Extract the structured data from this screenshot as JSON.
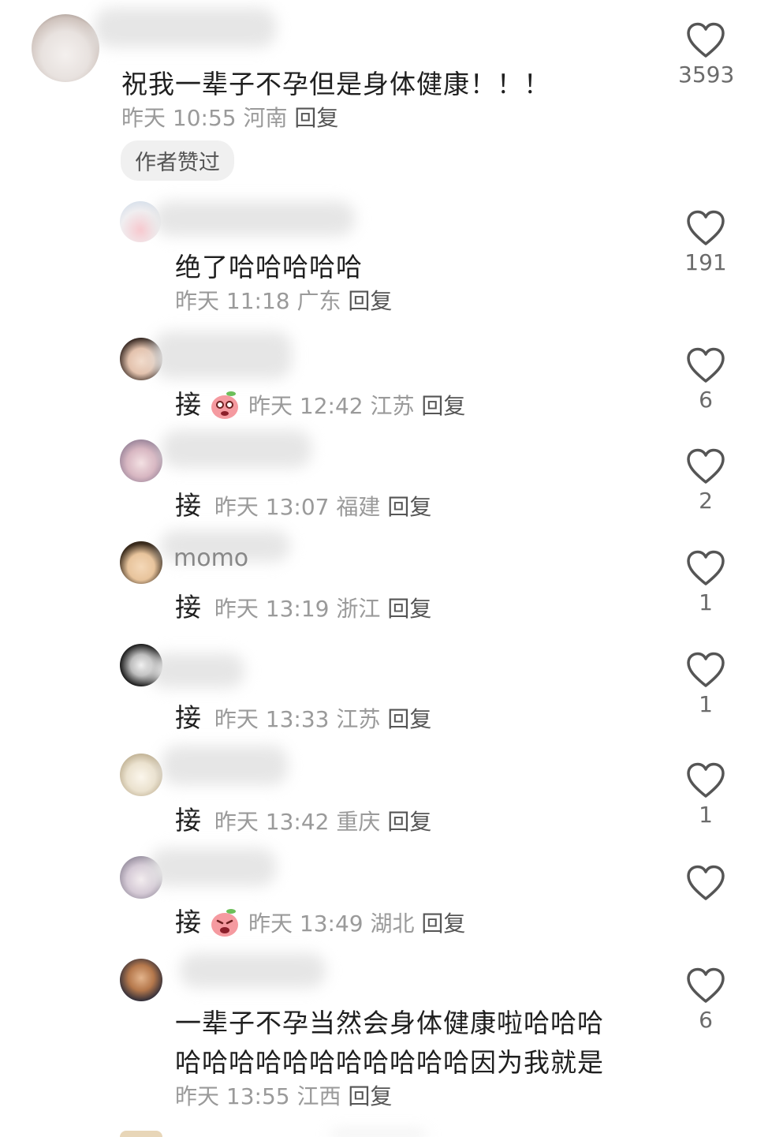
{
  "comments": [
    {
      "text": "祝我一辈子不孕但是身体健康！！！",
      "time": "昨天 10:55",
      "region": "河南",
      "reply": "回复",
      "likes": "3593",
      "badge": "作者赞过"
    },
    {
      "text": "绝了哈哈哈哈哈",
      "time": "昨天 11:18",
      "region": "广东",
      "reply": "回复",
      "likes": "191"
    },
    {
      "prefix": "接",
      "time": "昨天 12:42",
      "region": "江苏",
      "reply": "回复",
      "likes": "6"
    },
    {
      "prefix": "接",
      "time": "昨天 13:07",
      "region": "福建",
      "reply": "回复",
      "likes": "2"
    },
    {
      "prefix": "接",
      "time": "昨天 13:19",
      "region": "浙江",
      "reply": "回复",
      "likes": "1"
    },
    {
      "prefix": "接",
      "time": "昨天 13:33",
      "region": "江苏",
      "reply": "回复",
      "likes": "1"
    },
    {
      "prefix": "接",
      "time": "昨天 13:42",
      "region": "重庆",
      "reply": "回复",
      "likes": "1"
    },
    {
      "prefix": "接",
      "time": "昨天 13:49",
      "region": "湖北",
      "reply": "回复",
      "likes": ""
    },
    {
      "text_line1": "一辈子不孕当然会身体健康啦哈哈哈",
      "text_line2": "哈哈哈哈哈哈哈哈哈哈哈因为我就是",
      "time": "昨天 13:55",
      "region": "江西",
      "reply": "回复",
      "likes": "6"
    }
  ],
  "partial_name_fragments": [
    "momo"
  ],
  "colors": {
    "meta": "#9a9a9a",
    "text": "#1f1f1f",
    "heart_stroke": "#555555",
    "badge_bg": "#f0f0f0"
  }
}
